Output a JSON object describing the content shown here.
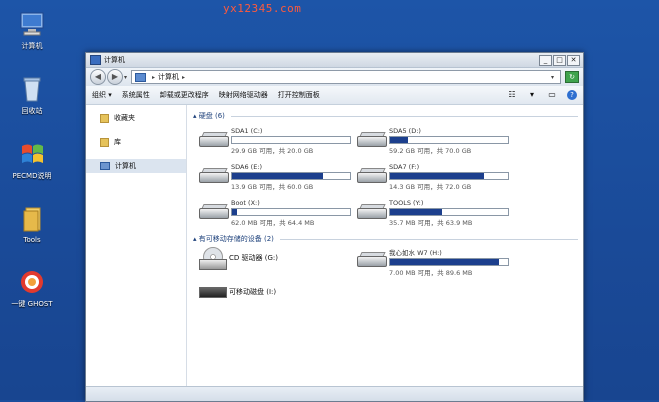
{
  "watermark": "yx12345.com",
  "desktop_icons": [
    {
      "label": "计算机",
      "icon": "computer-icon"
    },
    {
      "label": "回收站",
      "icon": "recycle-bin-icon"
    },
    {
      "label": "PECMD说明",
      "icon": "pecmd-icon"
    },
    {
      "label": "Tools",
      "icon": "folder-icon"
    },
    {
      "label": "一键 GHOST",
      "icon": "ghost-icon"
    }
  ],
  "window": {
    "title": "计算机",
    "address": {
      "location": "计算机"
    },
    "toolbar": {
      "organize": "组织 ▾",
      "system_properties": "系统属性",
      "uninstall": "卸载或更改程序",
      "map_drive": "映射网络驱动器",
      "control_panel": "打开控制面板"
    },
    "nav": [
      {
        "label": "收藏夹",
        "icon": "folder-icon"
      },
      {
        "label": "库",
        "icon": "folder-icon"
      },
      {
        "label": "计算机",
        "icon": "computer-icon"
      }
    ],
    "groups": {
      "hard_disks": "硬盘 (6)",
      "removable": "有可移动存储的设备 (2)"
    },
    "drives": [
      {
        "name": "SDA1 (C:)",
        "size": "29.9 GB 可用，共 20.0 GB",
        "fill": 0.0
      },
      {
        "name": "SDA5 (D:)",
        "size": "59.2 GB 可用，共 70.0 GB",
        "fill": 0.15
      },
      {
        "name": "SDA6 (E:)",
        "size": "13.9 GB 可用，共 60.0 GB",
        "fill": 0.77
      },
      {
        "name": "SDA7 (F:)",
        "size": "14.3 GB 可用，共 72.0 GB",
        "fill": 0.8
      },
      {
        "name": "Boot (X:)",
        "size": "62.0 MB 可用，共 64.4 MB",
        "fill": 0.04
      },
      {
        "name": "TOOLS (Y:)",
        "size": "35.7 MB 可用，共 63.9 MB",
        "fill": 0.44
      }
    ],
    "removable": [
      {
        "name": "CD 驱动器 (G:)",
        "icon": "cd-drive-icon"
      },
      {
        "name": "可移动磁盘 (I:)",
        "icon": "usb-drive-icon"
      }
    ],
    "usb_drive": {
      "name": "我心如水 W7 (H:)",
      "size": "7.00 MB 可用，共 89.6 MB",
      "fill": 0.92
    }
  }
}
